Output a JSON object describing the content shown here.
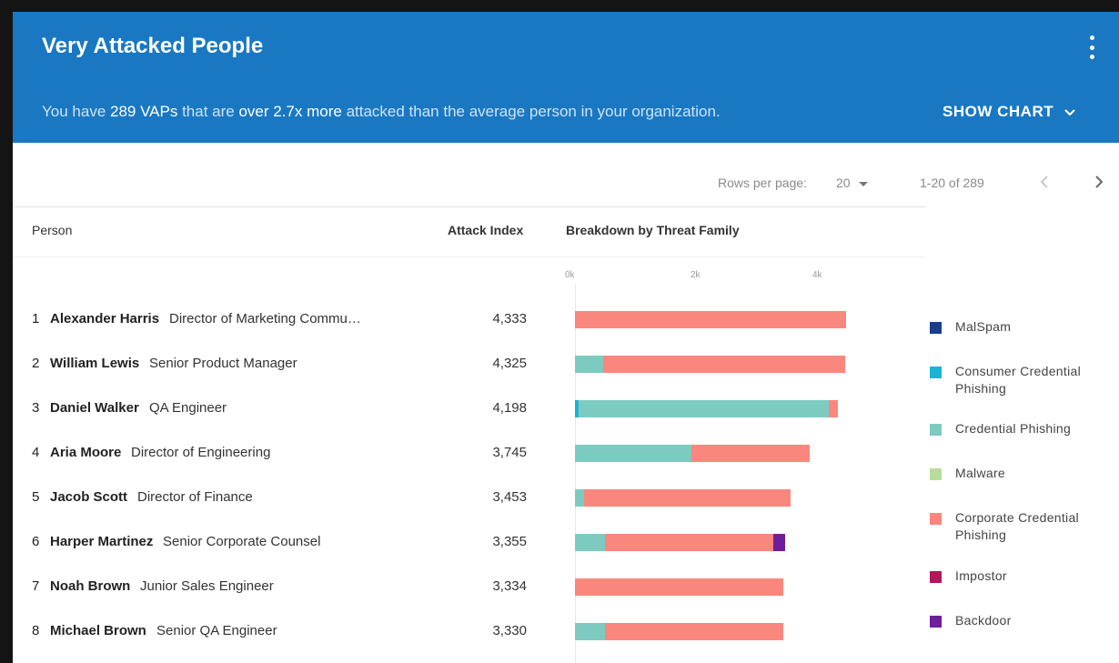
{
  "banner": {
    "title": "Very Attacked People",
    "summary_prefix": "You have ",
    "summary_count": "289 VAPs",
    "summary_mid": " that are ",
    "summary_multiplier": "over 2.7x more",
    "summary_suffix": " attacked than the average person in your organization.",
    "show_chart_label": "SHOW CHART",
    "menu_icon": "more-vert-icon",
    "chevron_icon": "chevron-down-icon"
  },
  "pagination": {
    "rows_per_page_label": "Rows per page:",
    "rows_per_page_value": "20",
    "range_text": "1-20 of 289",
    "prev_icon": "chevron-left-icon",
    "next_icon": "chevron-right-icon"
  },
  "columns": {
    "person": "Person",
    "attack_index": "Attack Index",
    "breakdown": "Breakdown by Threat Family"
  },
  "axis_ticks": [
    "0k",
    "2k",
    "4k"
  ],
  "colors": {
    "MalSpam": "#1a3d8f",
    "Consumer Credential Phishing": "#1bb3d1",
    "Credential Phishing": "#7dcbc0",
    "Malware": "#b9db9c",
    "Corporate Credential Phishing": "#fa877d",
    "Impostor": "#b3175a",
    "Backdoor": "#6e1e9b"
  },
  "legend": [
    {
      "label": "MalSpam",
      "color": "#1a3d8f"
    },
    {
      "label": "Consumer Credential Phishing",
      "color": "#1bb3d1"
    },
    {
      "label": "Credential Phishing",
      "color": "#7dcbc0"
    },
    {
      "label": "Malware",
      "color": "#b9db9c"
    },
    {
      "label": "Corporate Credential Phishing",
      "color": "#fa877d"
    },
    {
      "label": "Impostor",
      "color": "#b3175a"
    },
    {
      "label": "Backdoor",
      "color": "#6e1e9b"
    }
  ],
  "people": [
    {
      "rank": "1",
      "name": "Alexander Harris",
      "title": "Director of Marketing Commu…",
      "attack_index": "4,333",
      "breakdown": {
        "Corporate Credential Phishing": 4333
      }
    },
    {
      "rank": "2",
      "name": "William Lewis",
      "title": "Senior Product Manager",
      "attack_index": "4,325",
      "breakdown": {
        "Credential Phishing": 450,
        "Corporate Credential Phishing": 3875
      }
    },
    {
      "rank": "3",
      "name": "Daniel Walker",
      "title": "QA Engineer",
      "attack_index": "4,198",
      "breakdown": {
        "Consumer Credential Phishing": 60,
        "Credential Phishing": 4000,
        "Corporate Credential Phishing": 138
      }
    },
    {
      "rank": "4",
      "name": "Aria Moore",
      "title": "Director of Engineering",
      "attack_index": "3,745",
      "breakdown": {
        "Credential Phishing": 1860,
        "Corporate Credential Phishing": 1885
      }
    },
    {
      "rank": "5",
      "name": "Jacob Scott",
      "title": "Director of Finance",
      "attack_index": "3,453",
      "breakdown": {
        "Credential Phishing": 150,
        "Corporate Credential Phishing": 3303
      }
    },
    {
      "rank": "6",
      "name": "Harper Martinez",
      "title": "Senior Corporate Counsel",
      "attack_index": "3,355",
      "breakdown": {
        "Credential Phishing": 480,
        "Corporate Credential Phishing": 2695,
        "Backdoor": 180
      }
    },
    {
      "rank": "7",
      "name": "Noah Brown",
      "title": "Junior Sales Engineer",
      "attack_index": "3,334",
      "breakdown": {
        "Corporate Credential Phishing": 3334
      }
    },
    {
      "rank": "8",
      "name": "Michael Brown",
      "title": "Senior QA Engineer",
      "attack_index": "3,330",
      "breakdown": {
        "Credential Phishing": 480,
        "Corporate Credential Phishing": 2850
      }
    }
  ],
  "chart_data": {
    "type": "bar",
    "orientation": "horizontal",
    "stacked": true,
    "xlabel": "",
    "ylabel": "",
    "xlim": [
      0,
      4333
    ],
    "x_ticks": [
      "0k",
      "2k",
      "4k"
    ],
    "categories": [
      "Alexander Harris",
      "William Lewis",
      "Daniel Walker",
      "Aria Moore",
      "Jacob Scott",
      "Harper Martinez",
      "Noah Brown",
      "Michael Brown"
    ],
    "series": [
      {
        "name": "Consumer Credential Phishing",
        "values": [
          0,
          0,
          60,
          0,
          0,
          0,
          0,
          0
        ]
      },
      {
        "name": "Credential Phishing",
        "values": [
          0,
          450,
          4000,
          1860,
          150,
          480,
          0,
          480
        ]
      },
      {
        "name": "Corporate Credential Phishing",
        "values": [
          4333,
          3875,
          138,
          1885,
          3303,
          2695,
          3334,
          2850
        ]
      },
      {
        "name": "Backdoor",
        "values": [
          0,
          0,
          0,
          0,
          0,
          180,
          0,
          0
        ]
      }
    ],
    "legend": [
      "MalSpam",
      "Consumer Credential Phishing",
      "Credential Phishing",
      "Malware",
      "Corporate Credential Phishing",
      "Impostor",
      "Backdoor"
    ],
    "legend_position": "right"
  }
}
